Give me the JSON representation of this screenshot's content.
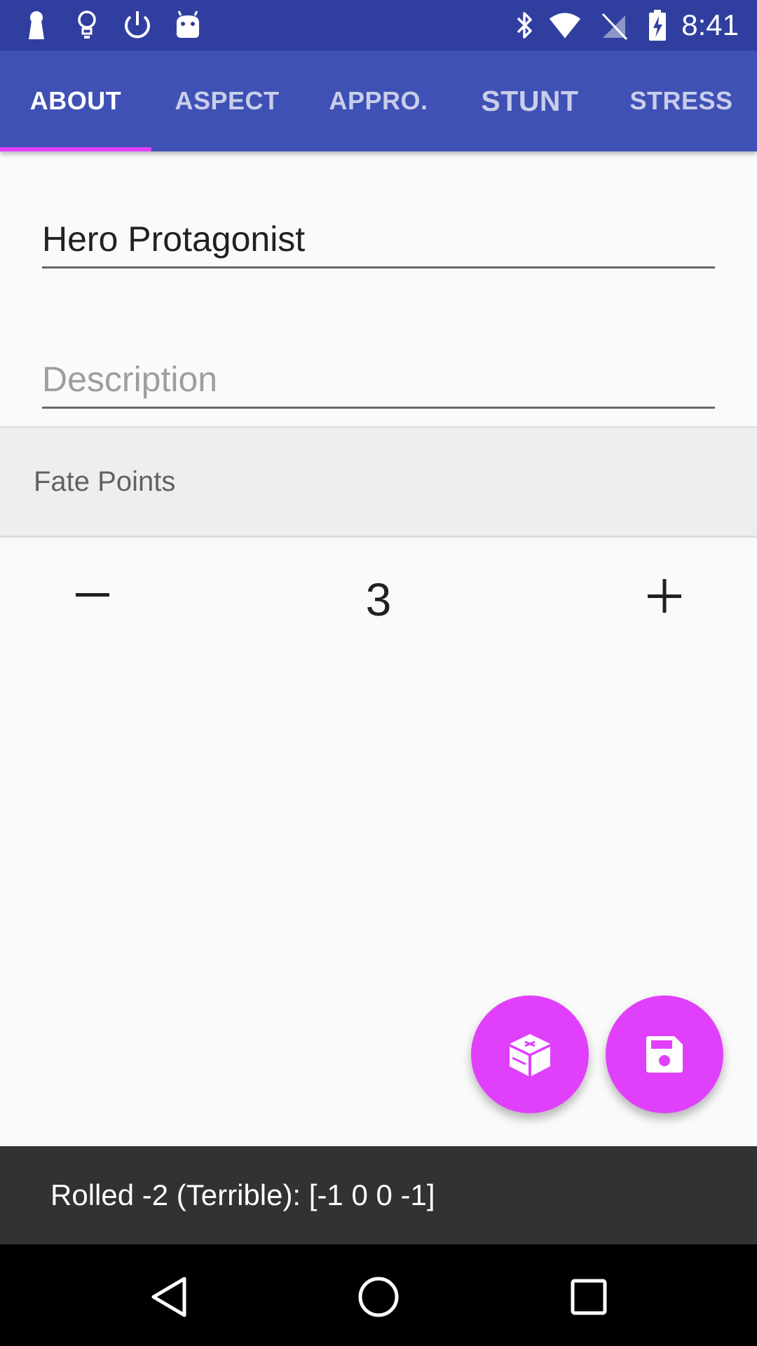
{
  "status_bar": {
    "time": "8:41",
    "left_icons": [
      "keyhole-icon",
      "lightbulb-icon",
      "power-icon",
      "android-icon"
    ],
    "right_icons": [
      "bluetooth-icon",
      "wifi-icon",
      "no-signal-icon",
      "battery-charging-icon"
    ]
  },
  "tabs": [
    {
      "label": "ABOUT",
      "active": true
    },
    {
      "label": "ASPECT",
      "active": false
    },
    {
      "label": "APPRO.",
      "active": false
    },
    {
      "label": "STUNT",
      "active": false
    },
    {
      "label": "STRESS",
      "active": false
    }
  ],
  "form": {
    "name_value": "Hero Protagonist",
    "description_placeholder": "Description"
  },
  "fate_points": {
    "label": "Fate Points",
    "value": "3",
    "decrement_label": "−",
    "increment_label": "+"
  },
  "fabs": {
    "roll_icon": "dice-icon",
    "save_icon": "save-icon"
  },
  "snackbar": {
    "message": "Rolled -2 (Terrible): [-1 0 0 -1]"
  },
  "nav_bar": {
    "icons": [
      "back-icon",
      "home-icon",
      "recents-icon"
    ]
  },
  "colors": {
    "primary": "#3f51b5",
    "primary_dark": "#303f9f",
    "accent": "#e040fb"
  }
}
